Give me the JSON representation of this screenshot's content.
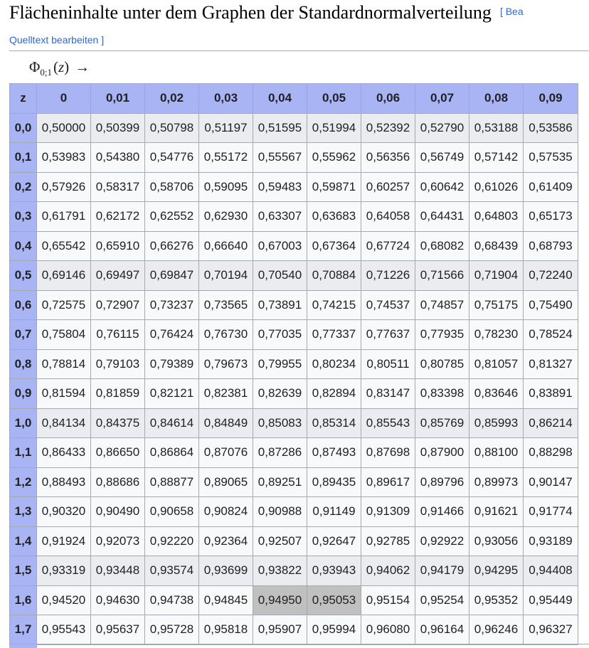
{
  "section": {
    "title": "Flächeninhalte unter dem Graphen der Standardnormalverteilung",
    "edit_bracket_open": "[",
    "edit_link_part1": "Bea",
    "edit_link_part2": "Quelltext bearbeiten",
    "edit_bracket_close": "]"
  },
  "formula": {
    "symbol": "Φ",
    "subscript": "0;1",
    "open_paren": "(",
    "variable": "z",
    "close_paren": ")",
    "arrow": "→"
  },
  "table": {
    "corner_header": "z",
    "column_headers": [
      "0",
      "0,01",
      "0,02",
      "0,03",
      "0,04",
      "0,05",
      "0,06",
      "0,07",
      "0,08",
      "0,09"
    ],
    "rows": [
      {
        "z": "0,0",
        "values": [
          "0,50000",
          "0,50399",
          "0,50798",
          "0,51197",
          "0,51595",
          "0,51994",
          "0,52392",
          "0,52790",
          "0,53188",
          "0,53586"
        ]
      },
      {
        "z": "0,1",
        "values": [
          "0,53983",
          "0,54380",
          "0,54776",
          "0,55172",
          "0,55567",
          "0,55962",
          "0,56356",
          "0,56749",
          "0,57142",
          "0,57535"
        ]
      },
      {
        "z": "0,2",
        "values": [
          "0,57926",
          "0,58317",
          "0,58706",
          "0,59095",
          "0,59483",
          "0,59871",
          "0,60257",
          "0,60642",
          "0,61026",
          "0,61409"
        ]
      },
      {
        "z": "0,3",
        "values": [
          "0,61791",
          "0,62172",
          "0,62552",
          "0,62930",
          "0,63307",
          "0,63683",
          "0,64058",
          "0,64431",
          "0,64803",
          "0,65173"
        ]
      },
      {
        "z": "0,4",
        "values": [
          "0,65542",
          "0,65910",
          "0,66276",
          "0,66640",
          "0,67003",
          "0,67364",
          "0,67724",
          "0,68082",
          "0,68439",
          "0,68793"
        ]
      },
      {
        "z": "0,5",
        "values": [
          "0,69146",
          "0,69497",
          "0,69847",
          "0,70194",
          "0,70540",
          "0,70884",
          "0,71226",
          "0,71566",
          "0,71904",
          "0,72240"
        ]
      },
      {
        "z": "0,6",
        "values": [
          "0,72575",
          "0,72907",
          "0,73237",
          "0,73565",
          "0,73891",
          "0,74215",
          "0,74537",
          "0,74857",
          "0,75175",
          "0,75490"
        ]
      },
      {
        "z": "0,7",
        "values": [
          "0,75804",
          "0,76115",
          "0,76424",
          "0,76730",
          "0,77035",
          "0,77337",
          "0,77637",
          "0,77935",
          "0,78230",
          "0,78524"
        ]
      },
      {
        "z": "0,8",
        "values": [
          "0,78814",
          "0,79103",
          "0,79389",
          "0,79673",
          "0,79955",
          "0,80234",
          "0,80511",
          "0,80785",
          "0,81057",
          "0,81327"
        ]
      },
      {
        "z": "0,9",
        "values": [
          "0,81594",
          "0,81859",
          "0,82121",
          "0,82381",
          "0,82639",
          "0,82894",
          "0,83147",
          "0,83398",
          "0,83646",
          "0,83891"
        ]
      },
      {
        "z": "1,0",
        "values": [
          "0,84134",
          "0,84375",
          "0,84614",
          "0,84849",
          "0,85083",
          "0,85314",
          "0,85543",
          "0,85769",
          "0,85993",
          "0,86214"
        ]
      },
      {
        "z": "1,1",
        "values": [
          "0,86433",
          "0,86650",
          "0,86864",
          "0,87076",
          "0,87286",
          "0,87493",
          "0,87698",
          "0,87900",
          "0,88100",
          "0,88298"
        ]
      },
      {
        "z": "1,2",
        "values": [
          "0,88493",
          "0,88686",
          "0,88877",
          "0,89065",
          "0,89251",
          "0,89435",
          "0,89617",
          "0,89796",
          "0,89973",
          "0,90147"
        ]
      },
      {
        "z": "1,3",
        "values": [
          "0,90320",
          "0,90490",
          "0,90658",
          "0,90824",
          "0,90988",
          "0,91149",
          "0,91309",
          "0,91466",
          "0,91621",
          "0,91774"
        ]
      },
      {
        "z": "1,4",
        "values": [
          "0,91924",
          "0,92073",
          "0,92220",
          "0,92364",
          "0,92507",
          "0,92647",
          "0,92785",
          "0,92922",
          "0,93056",
          "0,93189"
        ]
      },
      {
        "z": "1,5",
        "values": [
          "0,93319",
          "0,93448",
          "0,93574",
          "0,93699",
          "0,93822",
          "0,93943",
          "0,94062",
          "0,94179",
          "0,94295",
          "0,94408"
        ]
      },
      {
        "z": "1,6",
        "values": [
          "0,94520",
          "0,94630",
          "0,94738",
          "0,94845",
          "0,94950",
          "0,95053",
          "0,95154",
          "0,95254",
          "0,95352",
          "0,95449"
        ]
      },
      {
        "z": "1,7",
        "values": [
          "0,95543",
          "0,95637",
          "0,95728",
          "0,95818",
          "0,95907",
          "0,95994",
          "0,96080",
          "0,96164",
          "0,96246",
          "0,96327"
        ]
      }
    ],
    "shaded_row_labels": [
      "0,0",
      "0,5",
      "1,0",
      "1,5"
    ],
    "highlighted_cells": [
      {
        "row": "1,6",
        "column": "0,04"
      },
      {
        "row": "1,6",
        "column": "0,05"
      }
    ]
  },
  "colors": {
    "header_background": "#a9b4f5",
    "cell_background": "#f8f9fa",
    "shaded_row_background": "#eaecf0",
    "highlight_background": "#c0c0c0",
    "border": "#a2a9b1",
    "link": "#3366cc",
    "text": "#202122"
  }
}
